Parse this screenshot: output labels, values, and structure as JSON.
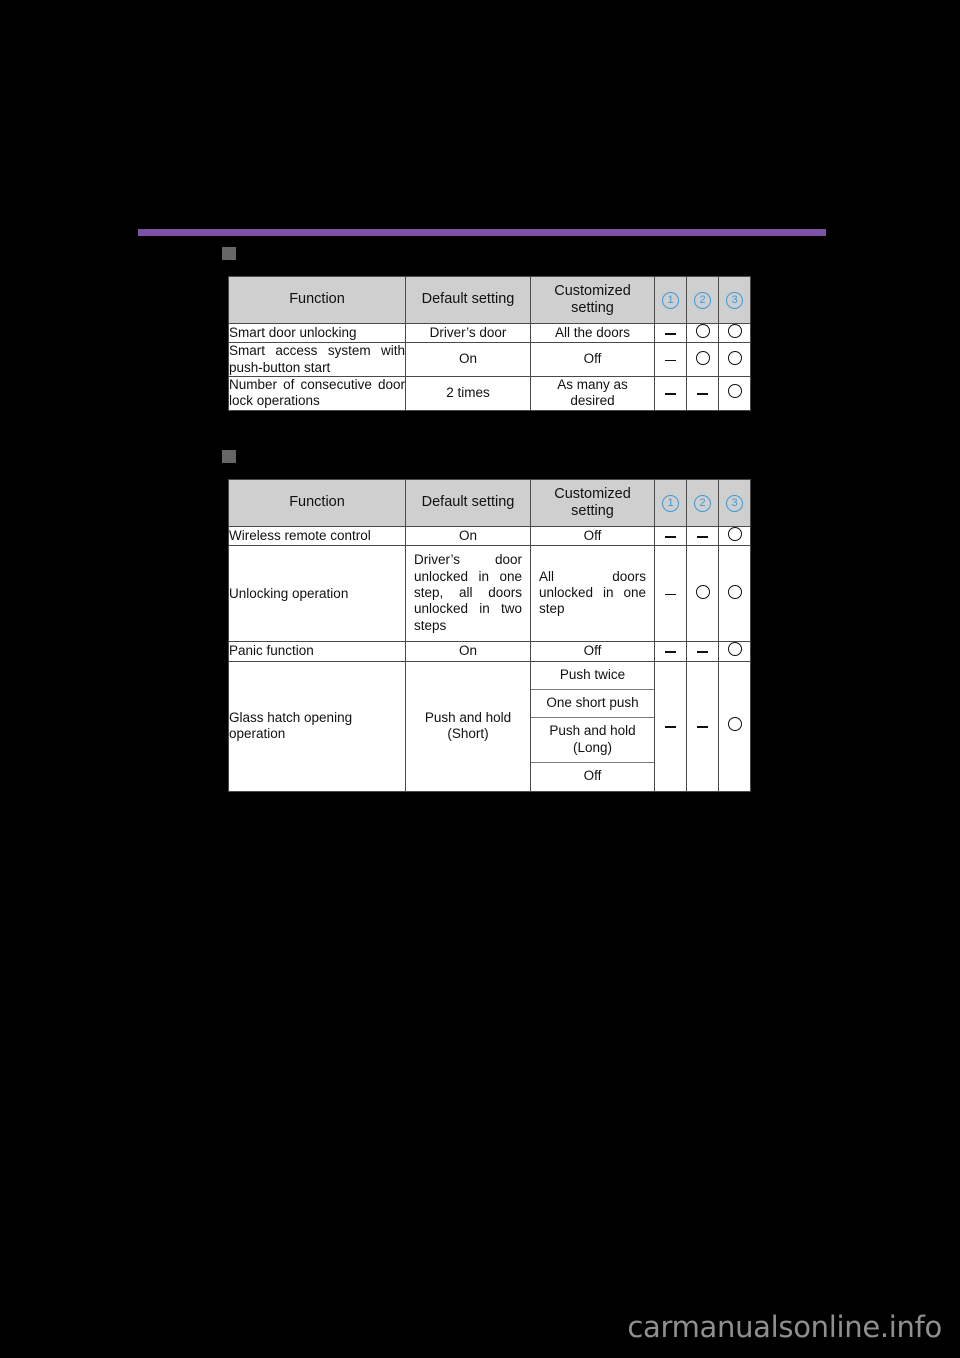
{
  "page": {
    "background_color": "#000000",
    "rule_color": "#7b52a5",
    "bullet_color": "#666666",
    "header_bg_color": "#cfcfcf",
    "index_color": "#3f9bd4",
    "watermark": "carmanualsonline.info"
  },
  "columns": {
    "function": "Function",
    "default_setting": "Default setting",
    "customized_setting": "Customized\nsetting",
    "index_1": "①",
    "index_2": "②",
    "index_3": "③",
    "index_1_num": "1",
    "index_2_num": "2",
    "index_3_num": "3"
  },
  "marks": {
    "available": "O",
    "not_available": "–"
  },
  "tables": [
    {
      "id": "table-one",
      "bullet": true,
      "header": {
        "function": "Function",
        "default_setting": "Default setting",
        "customized_setting_line1": "Customized",
        "customized_setting_line2": "setting",
        "index_1": "1",
        "index_2": "2",
        "index_3": "3"
      },
      "rows": [
        {
          "function": "Smart door unlocking",
          "justify_function": false,
          "default_setting": "Driver’s door",
          "customized_setting": "All the doors",
          "justify_customized": false,
          "m1": "–",
          "m2": "O",
          "m3": "O"
        },
        {
          "function": "Smart access system with push-button start",
          "justify_function": true,
          "default_setting": "On",
          "customized_setting": "Off",
          "justify_customized": false,
          "m1": "–",
          "m2": "O",
          "m3": "O"
        },
        {
          "function": "Number of consecutive door lock operations",
          "justify_function": true,
          "default_setting": "2 times",
          "customized_setting": "As many as\ndesired",
          "customized_line1": "As many as",
          "customized_line2": "desired",
          "justify_customized": false,
          "m1": "–",
          "m2": "–",
          "m3": "O"
        }
      ]
    },
    {
      "id": "table-two",
      "bullet": true,
      "header": {
        "function": "Function",
        "default_setting": "Default setting",
        "customized_setting_line1": "Customized",
        "customized_setting_line2": "setting",
        "index_1": "1",
        "index_2": "2",
        "index_3": "3"
      },
      "rows": [
        {
          "function": "Wireless remote control",
          "justify_function": false,
          "default_setting": "On",
          "customized_setting": "Off",
          "justify_customized": false,
          "m1": "–",
          "m2": "–",
          "m3": "O"
        },
        {
          "function": "Unlocking operation",
          "justify_function": false,
          "default_setting": "Driver’s door unlocked in one step, all doors unlocked in two steps",
          "justify_default": true,
          "customized_setting": "All doors unlocked in one step",
          "justify_customized": true,
          "m1": "–",
          "m2": "O",
          "m3": "O"
        },
        {
          "function": "Panic function",
          "justify_function": false,
          "default_setting": "On",
          "customized_setting": "Off",
          "justify_customized": false,
          "m1": "–",
          "m2": "–",
          "m3": "O"
        },
        {
          "function": "Glass hatch opening operation",
          "justify_function": false,
          "default_setting": "Push and hold\n(Short)",
          "default_line1": "Push and hold",
          "default_line2": "(Short)",
          "customized_options": [
            "Push twice",
            "One short push",
            "Push and hold\n(Long)",
            "Off"
          ],
          "customized_option_3_line1": "Push and hold",
          "customized_option_3_line2": "(Long)",
          "m1": "–",
          "m2": "–",
          "m3": "O"
        }
      ]
    }
  ]
}
